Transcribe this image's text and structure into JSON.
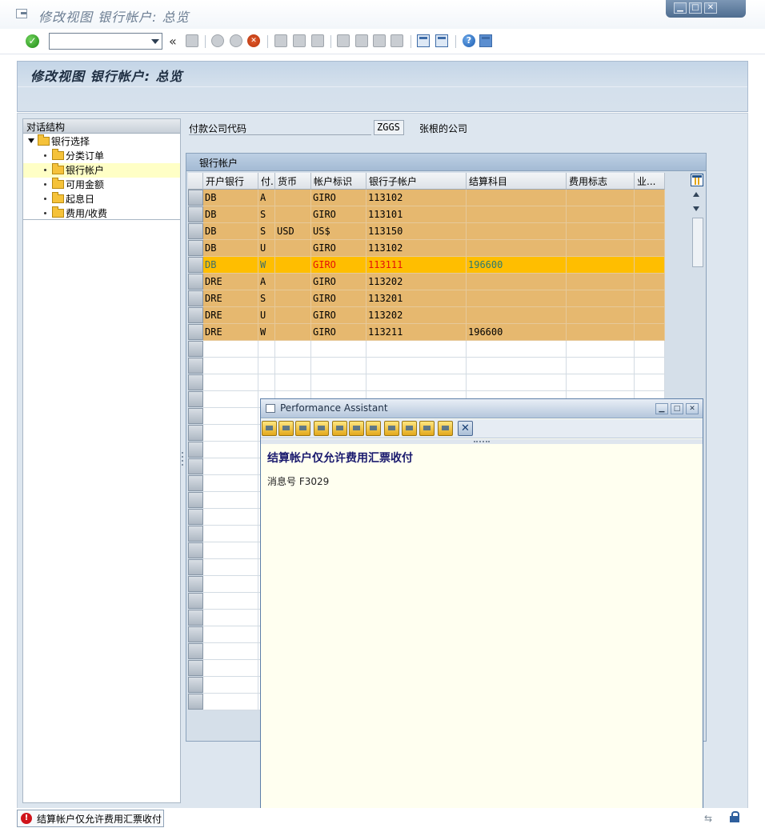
{
  "window": {
    "title": "修改视图 银行帐户: 总览",
    "controls": [
      "minimize",
      "maximize",
      "close"
    ]
  },
  "toolbar": {
    "command_field_value": "",
    "collapse_label": "«",
    "icons": [
      "ok-icon",
      "save-icon",
      "back-icon",
      "exit-icon",
      "cancel-icon",
      "print-icon",
      "find-icon",
      "find-next-icon",
      "first-page-icon",
      "previous-page-icon",
      "next-page-icon",
      "last-page-icon",
      "create-session-icon",
      "shortcut-icon",
      "help-icon",
      "layout-icon"
    ]
  },
  "header": {
    "title": "修改视图 银行帐户: 总览"
  },
  "tree": {
    "header": "对话结构",
    "root": "银行选择",
    "items": [
      {
        "label": "分类订单",
        "selected": false
      },
      {
        "label": "银行帐户",
        "selected": true
      },
      {
        "label": "可用金额",
        "selected": false
      },
      {
        "label": "起息日",
        "selected": false
      },
      {
        "label": "费用/收费",
        "selected": false
      }
    ]
  },
  "company": {
    "label": "付款公司代码",
    "code": "ZGGS",
    "name": "张根的公司"
  },
  "table": {
    "title": "银行帐户",
    "columns": [
      "开户银行",
      "付.",
      "货币",
      "帐户标识",
      "银行子帐户",
      "结算科目",
      "费用标志",
      "业..."
    ],
    "rows": [
      {
        "bank": "DB",
        "pay": "A",
        "curr": "",
        "acctid": "GIRO",
        "sub": "113102",
        "gl": "",
        "fee": "",
        "biz": ""
      },
      {
        "bank": "DB",
        "pay": "S",
        "curr": "",
        "acctid": "GIRO",
        "sub": "113101",
        "gl": "",
        "fee": "",
        "biz": ""
      },
      {
        "bank": "DB",
        "pay": "S",
        "curr": "USD",
        "acctid": "US$",
        "sub": "113150",
        "gl": "",
        "fee": "",
        "biz": ""
      },
      {
        "bank": "DB",
        "pay": "U",
        "curr": "",
        "acctid": "GIRO",
        "sub": "113102",
        "gl": "",
        "fee": "",
        "biz": ""
      },
      {
        "bank": "DB",
        "pay": "W",
        "curr": "",
        "acctid": "GIRO",
        "sub": "113111",
        "gl": "196600",
        "fee": "",
        "biz": ""
      },
      {
        "bank": "DRE",
        "pay": "A",
        "curr": "",
        "acctid": "GIRO",
        "sub": "113202",
        "gl": "",
        "fee": "",
        "biz": ""
      },
      {
        "bank": "DRE",
        "pay": "S",
        "curr": "",
        "acctid": "GIRO",
        "sub": "113201",
        "gl": "",
        "fee": "",
        "biz": ""
      },
      {
        "bank": "DRE",
        "pay": "U",
        "curr": "",
        "acctid": "GIRO",
        "sub": "113202",
        "gl": "",
        "fee": "",
        "biz": ""
      },
      {
        "bank": "DRE",
        "pay": "W",
        "curr": "",
        "acctid": "GIRO",
        "sub": "113211",
        "gl": "196600",
        "fee": "",
        "biz": ""
      }
    ],
    "highlighted_row": 4,
    "empty_rows": 23
  },
  "assistant": {
    "title": "Performance Assistant",
    "heading": "结算帐户仅允许费用汇票收付",
    "message": "消息号 F3029",
    "toolbar_icons": [
      "back-icon",
      "forward-icon",
      "home-icon",
      "technical-info-icon",
      "edit-icon",
      "glossary-icon",
      "find-icon",
      "book-icon",
      "notes-icon",
      "settings-icon",
      "print-icon",
      "close-icon"
    ]
  },
  "status": {
    "message": "结算帐户仅允许费用汇票收付",
    "type": "error",
    "arrows": "⇆"
  },
  "colors": {
    "row_fill": "#e6b86f",
    "row_highlight": "#ffbe00",
    "header_band": "#c4d5e7",
    "assistant_bg": "#fffff0"
  }
}
